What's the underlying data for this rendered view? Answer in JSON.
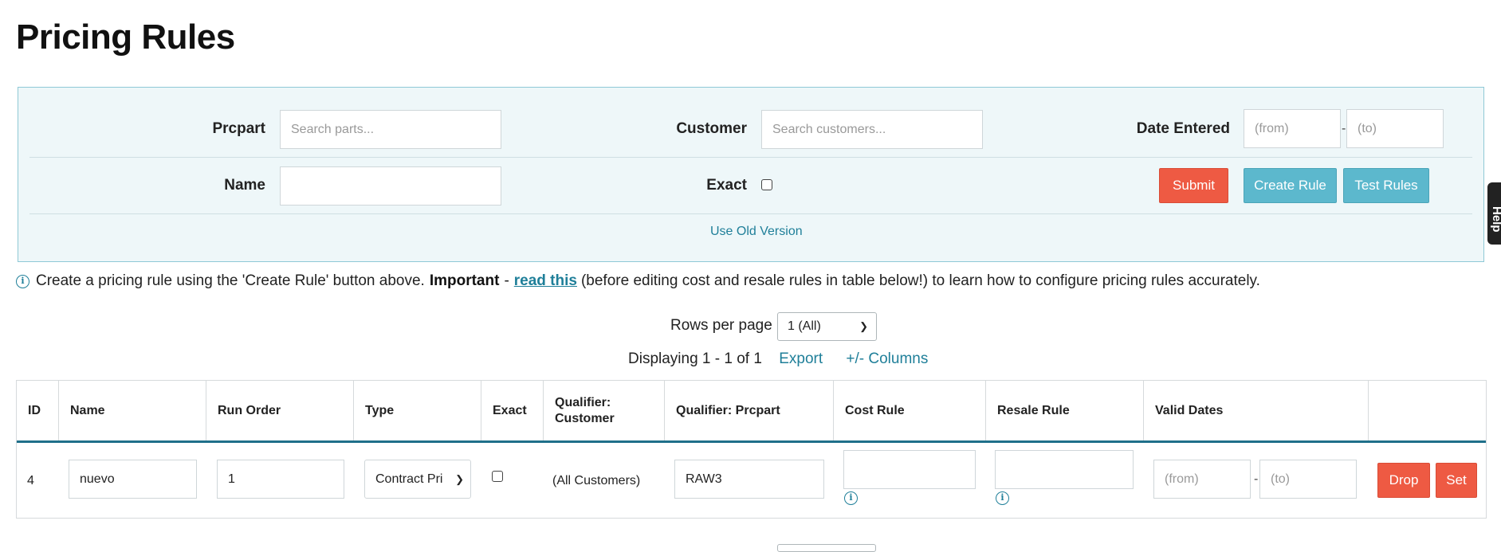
{
  "page": {
    "title": "Pricing Rules"
  },
  "filters": {
    "prcpart": {
      "label": "Prcpart",
      "placeholder": "Search parts..."
    },
    "customer": {
      "label": "Customer",
      "placeholder": "Search customers..."
    },
    "date_entered": {
      "label": "Date Entered",
      "from_placeholder": "(from)",
      "to_placeholder": "(to)",
      "separator": "-"
    },
    "name": {
      "label": "Name",
      "value": ""
    },
    "exact": {
      "label": "Exact",
      "checked": false
    },
    "buttons": {
      "submit": "Submit",
      "create_rule": "Create Rule",
      "test_rules": "Test Rules"
    },
    "old_version_link": "Use Old Version"
  },
  "help_tab": {
    "label": "Help"
  },
  "info": {
    "icon": "info-circle-icon",
    "text_before": "Create a pricing rule using the 'Create Rule' button above.",
    "important": "Important",
    "dash": "-",
    "link": "read this",
    "text_after": "(before editing cost and resale rules in table below!) to learn how to configure pricing rules accurately."
  },
  "pagination": {
    "rows_per_page_label": "Rows per page",
    "rows_per_page_value": "1 (All)",
    "displaying": "Displaying 1 - 1 of 1",
    "export": "Export",
    "columns": "+/-  Columns"
  },
  "table": {
    "headers": [
      "ID",
      "Name",
      "Run Order",
      "Type",
      "Exact",
      "Qualifier: Customer",
      "Qualifier: Prcpart",
      "Cost Rule",
      "Resale Rule",
      "Valid Dates",
      ""
    ],
    "rows": [
      {
        "id": "4",
        "name": "nuevo",
        "run_order": "1",
        "type": "Contract Pri",
        "exact": false,
        "qualifier_customer": "(All Customers)",
        "qualifier_prcpart": "RAW3",
        "cost_rule": "",
        "resale_rule": "",
        "valid_from_placeholder": "(from)",
        "valid_to_placeholder": "(to)",
        "date_separator": "-",
        "drop": "Drop",
        "set": "Set"
      }
    ]
  },
  "colors": {
    "accent": "#1f7f99",
    "danger": "#ee5a43",
    "teal": "#5cb8cd",
    "panel_bg": "#eef7f9",
    "header_rule": "#1f6f8a"
  }
}
